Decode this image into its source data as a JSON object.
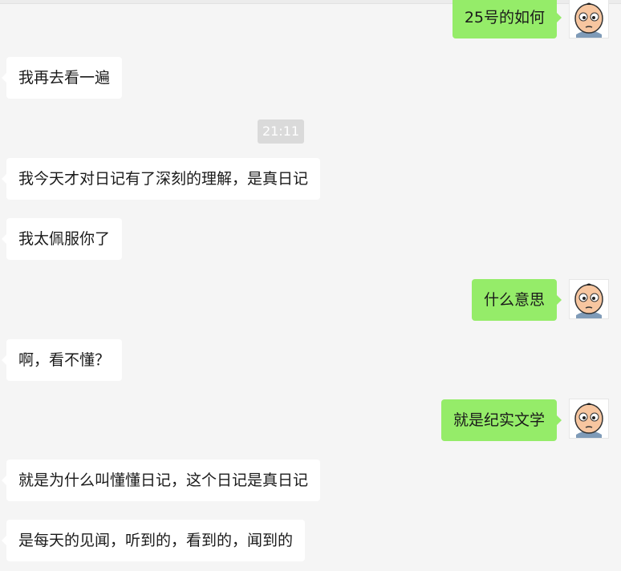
{
  "timestamp": "21:11",
  "messages": [
    {
      "side": "out",
      "text": "25号的如何"
    },
    {
      "side": "in",
      "text": "我再去看一遍"
    },
    {
      "side": "in",
      "text": "我今天才对日记有了深刻的理解，是真日记"
    },
    {
      "side": "in",
      "text": "我太佩服你了"
    },
    {
      "side": "out",
      "text": "什么意思"
    },
    {
      "side": "in",
      "text": "啊，看不懂？"
    },
    {
      "side": "out",
      "text": "就是纪实文学"
    },
    {
      "side": "in",
      "text": "就是为什么叫懂懂日记，这个日记是真日记"
    },
    {
      "side": "in",
      "text": "是每天的见闻，听到的，看到的，闻到的"
    }
  ],
  "colors": {
    "background": "#f5f5f5",
    "incoming_bubble": "#ffffff",
    "outgoing_bubble": "#95ec69",
    "timestamp_bg": "#dadada"
  },
  "icons": {
    "avatar": "cartoon-baby-face-avatar-icon"
  }
}
